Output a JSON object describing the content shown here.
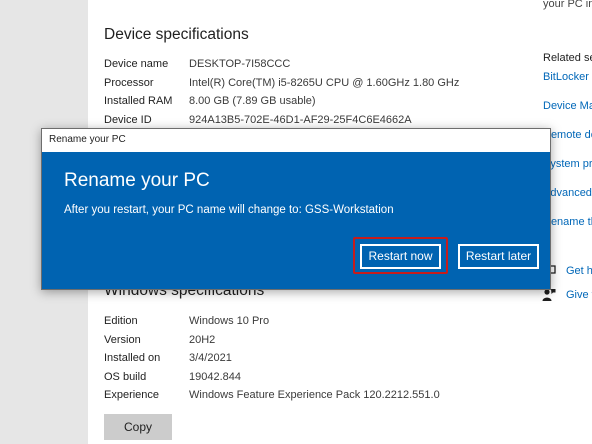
{
  "device_specs": {
    "heading": "Device specifications",
    "rows": [
      {
        "label": "Device name",
        "value": "DESKTOP-7I58CCC"
      },
      {
        "label": "Processor",
        "value": "Intel(R) Core(TM) i5-8265U CPU @ 1.60GHz   1.80 GHz"
      },
      {
        "label": "Installed RAM",
        "value": "8.00 GB (7.89 GB usable)"
      },
      {
        "label": "Device ID",
        "value": "924A13B5-702E-46D1-AF29-25F4C6E4662A"
      }
    ]
  },
  "windows_specs": {
    "heading": "Windows specifications",
    "rows": [
      {
        "label": "Edition",
        "value": "Windows 10 Pro"
      },
      {
        "label": "Version",
        "value": "20H2"
      },
      {
        "label": "Installed on",
        "value": "3/4/2021"
      },
      {
        "label": "OS build",
        "value": "19042.844"
      },
      {
        "label": "Experience",
        "value": "Windows Feature Experience Pack 120.2212.551.0"
      }
    ],
    "copy_label": "Copy"
  },
  "right_panel": {
    "top_text": "your PC inf",
    "related_heading": "Related set",
    "links": [
      "BitLocker s",
      "Device Ma",
      "Remote de",
      "System pro",
      "Advanced s",
      "Rename thi"
    ],
    "help_links": [
      {
        "label": "Get h",
        "icon": "help-chat-icon"
      },
      {
        "label": "Give f",
        "icon": "feedback-person-icon"
      }
    ]
  },
  "dialog": {
    "title": "Rename your PC",
    "heading": "Rename your PC",
    "message": "After you restart, your PC name will change to: GSS-Workstation",
    "restart_now": "Restart now",
    "restart_later": "Restart later"
  },
  "colors": {
    "accent": "#0063b1",
    "link": "#0067b8",
    "highlight": "#c61c1c"
  }
}
